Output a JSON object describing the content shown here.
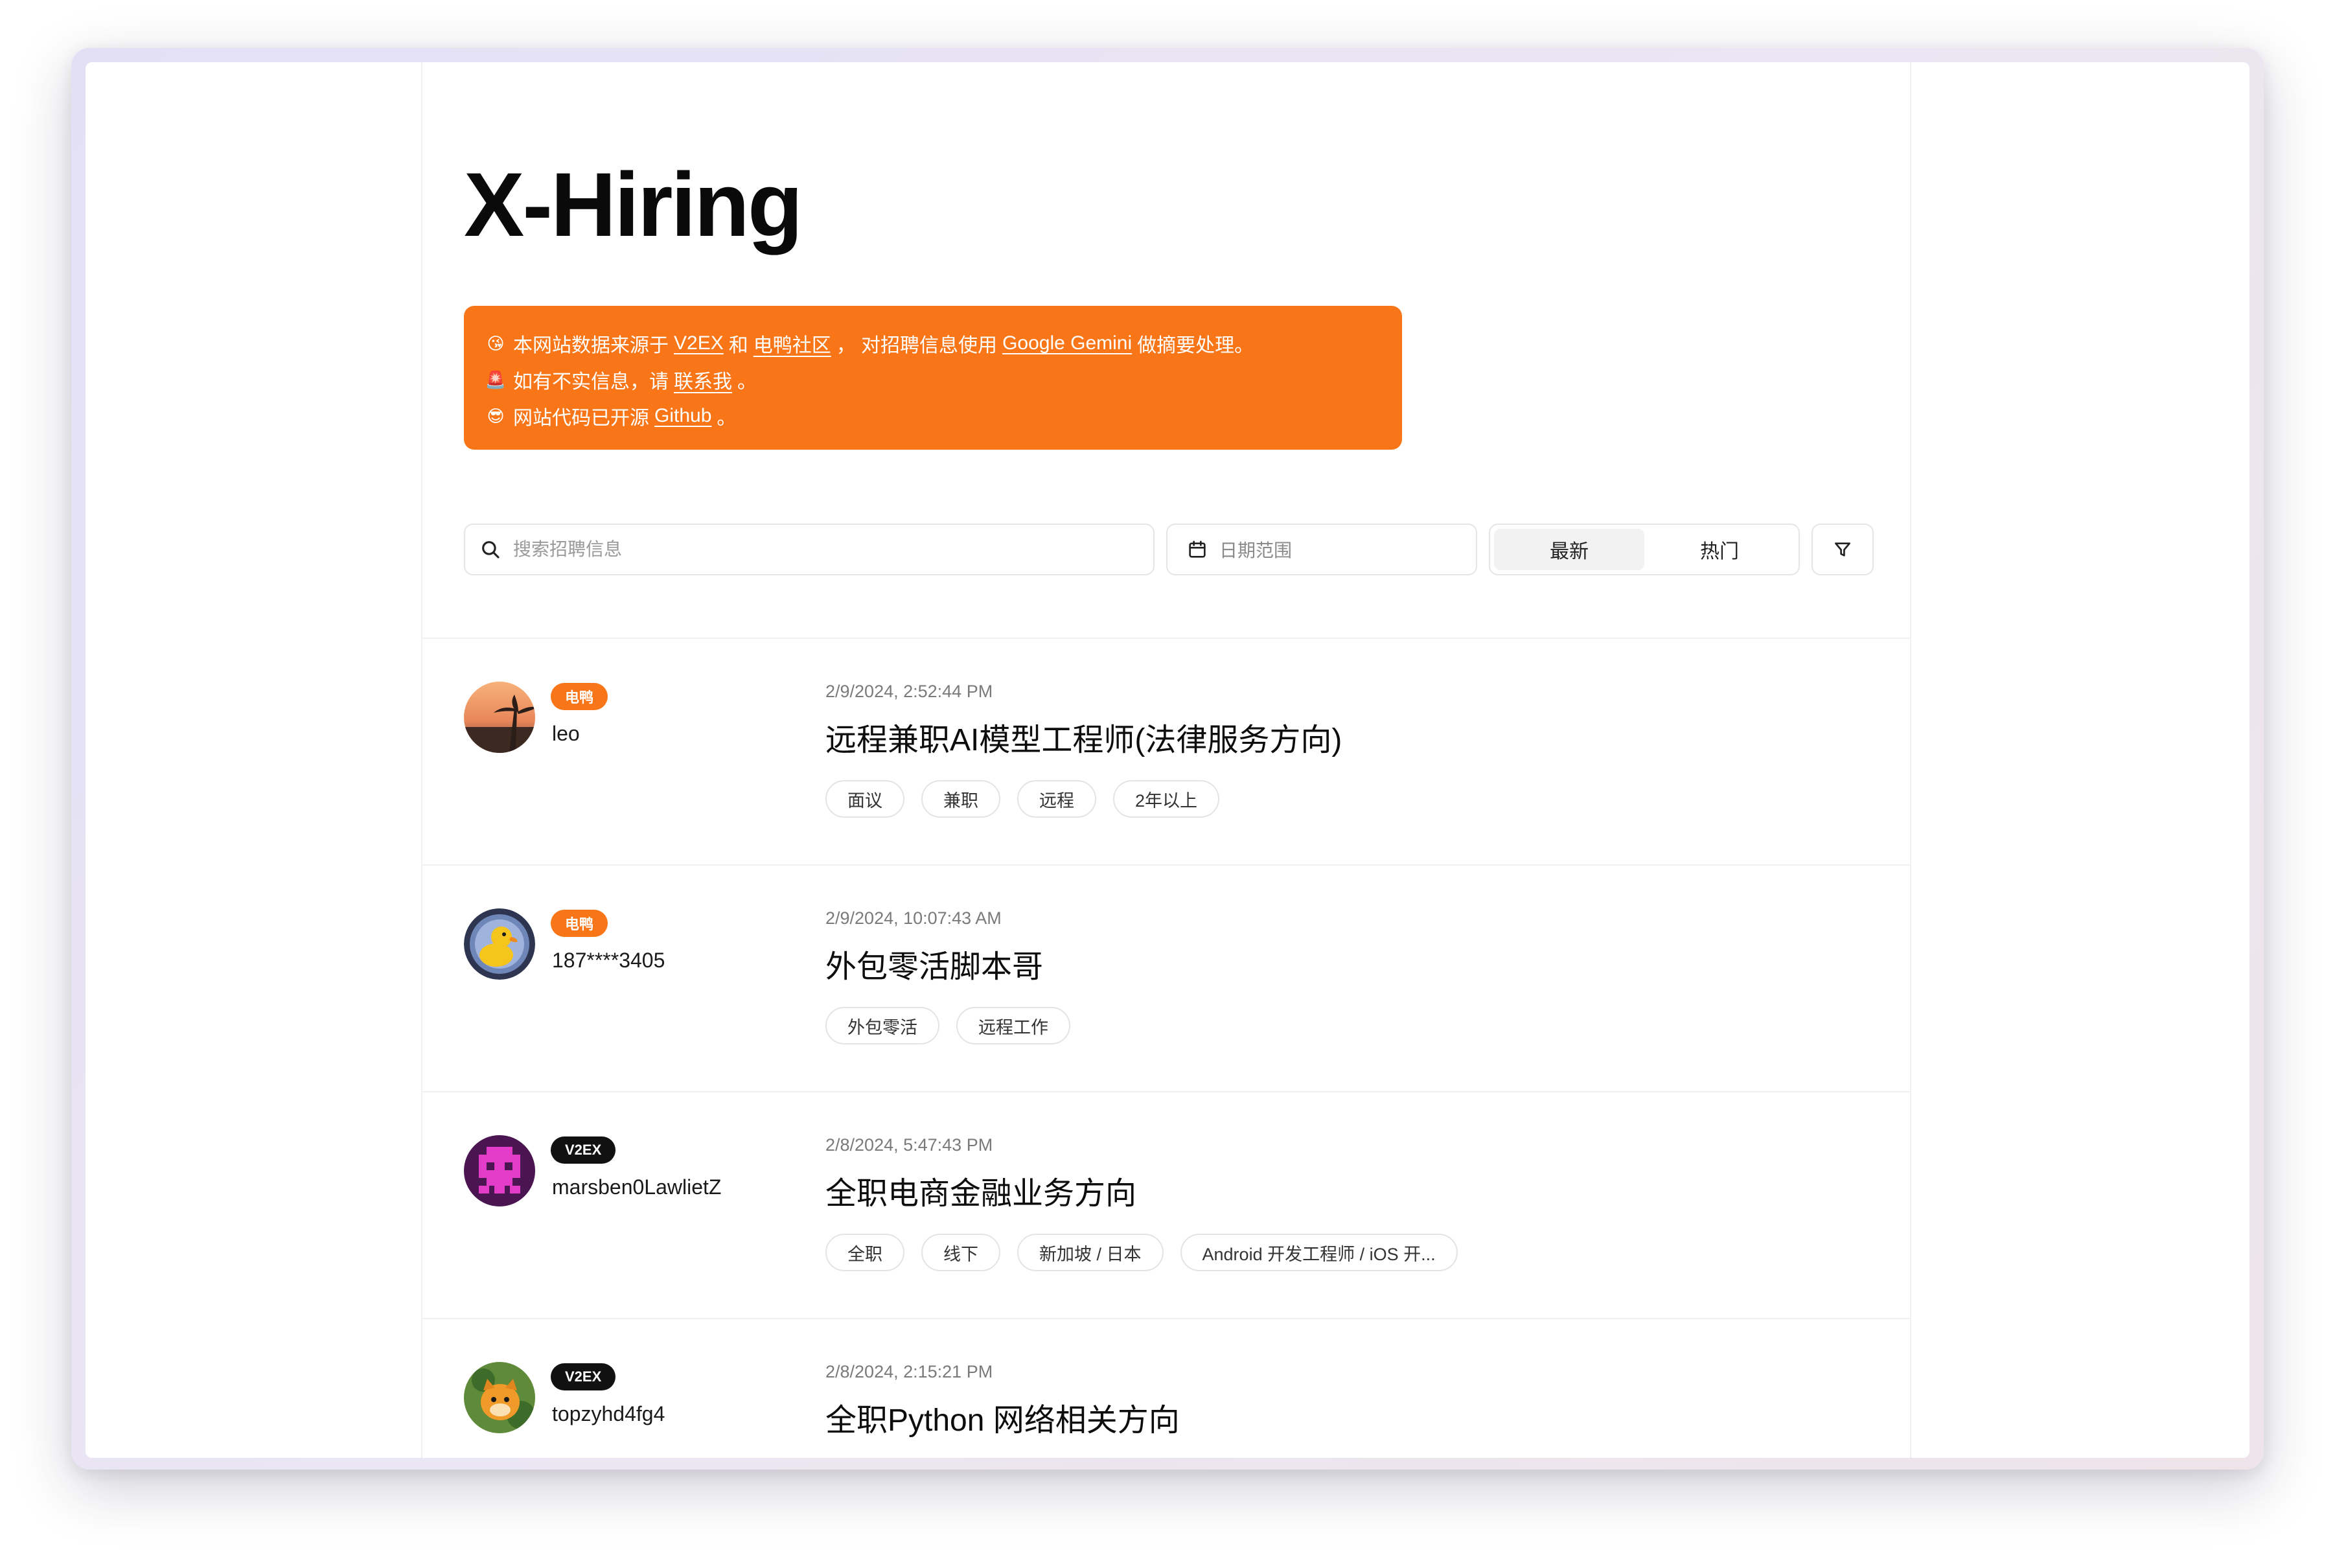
{
  "page_title": "X-Hiring",
  "notice": {
    "line1": {
      "emoji": "😘",
      "text_a": "本网站数据来源于",
      "link_v2ex": "V2EX",
      "text_b": "和",
      "link_dianya": "电鸭社区",
      "text_c": "， 对招聘信息使用",
      "link_gemini": "Google Gemini",
      "text_d": "做摘要处理。"
    },
    "line2": {
      "emoji": "🚨",
      "text_a": "如有不实信息，请",
      "link_contact": "联系我",
      "text_b": "。"
    },
    "line3": {
      "emoji": "😎",
      "text_a": "网站代码已开源",
      "link_github": "Github",
      "text_b": "。"
    }
  },
  "toolbar": {
    "search_placeholder": "搜索招聘信息",
    "date_placeholder": "日期范围",
    "sort_latest": "最新",
    "sort_hot": "热门"
  },
  "colors": {
    "accent": "#f97618",
    "badge_dark": "#111111"
  },
  "jobs": [
    {
      "source": "电鸭",
      "source_style": "orange",
      "username": "leo",
      "timestamp": "2/9/2024, 2:52:44 PM",
      "title": "远程兼职AI模型工程师(法律服务方向)",
      "tags": [
        "面议",
        "兼职",
        "远程",
        "2年以上"
      ]
    },
    {
      "source": "电鸭",
      "source_style": "orange",
      "username": "187****3405",
      "timestamp": "2/9/2024, 10:07:43 AM",
      "title": "外包零活脚本哥",
      "tags": [
        "外包零活",
        "远程工作"
      ]
    },
    {
      "source": "V2EX",
      "source_style": "dark",
      "username": "marsben0LawlietZ",
      "timestamp": "2/8/2024, 5:47:43 PM",
      "title": "全职电商金融业务方向",
      "tags": [
        "全职",
        "线下",
        "新加坡 / 日本",
        "Android 开发工程师 / iOS 开..."
      ]
    },
    {
      "source": "V2EX",
      "source_style": "dark",
      "username": "topzyhd4fg4",
      "timestamp": "2/8/2024, 2:15:21 PM",
      "title": "全职Python 网络相关方向",
      "tags": []
    }
  ]
}
